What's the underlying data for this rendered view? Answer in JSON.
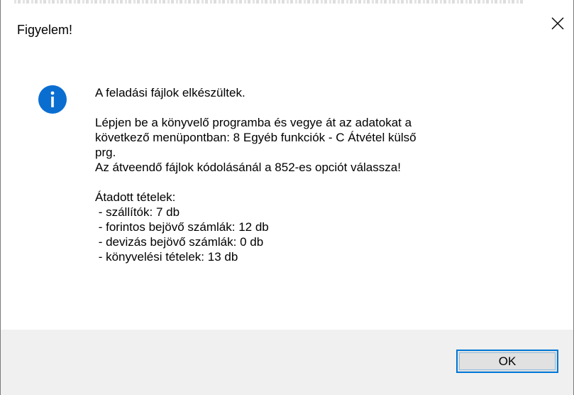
{
  "dialog": {
    "title": "Figyelem!",
    "close_icon": "close-icon",
    "icon": "info-icon",
    "message": {
      "line1": "A feladási fájlok elkészültek.",
      "line2": "Lépjen be a könyvelő programba és vegye át az adatokat a",
      "line3": "következő menüpontban: 8 Egyéb funkciók - C Átvétel külső",
      "line4": "prg.",
      "line5": "Az átveendő fájlok kódolásánál a 852-es opciót válassza!",
      "line6": "Átadott tételek:",
      "line7": " - szállítók: 7 db",
      "line8": " - forintos bejövő számlák: 12 db",
      "line9": " - devizás bejövő számlák: 0 db",
      "line10": " - könyvelési tételek: 13 db"
    },
    "ok_label": "OK"
  },
  "colors": {
    "accent": "#0078d7",
    "icon_blue": "#0a6ed1",
    "footer_bg": "#f0f0f0"
  }
}
